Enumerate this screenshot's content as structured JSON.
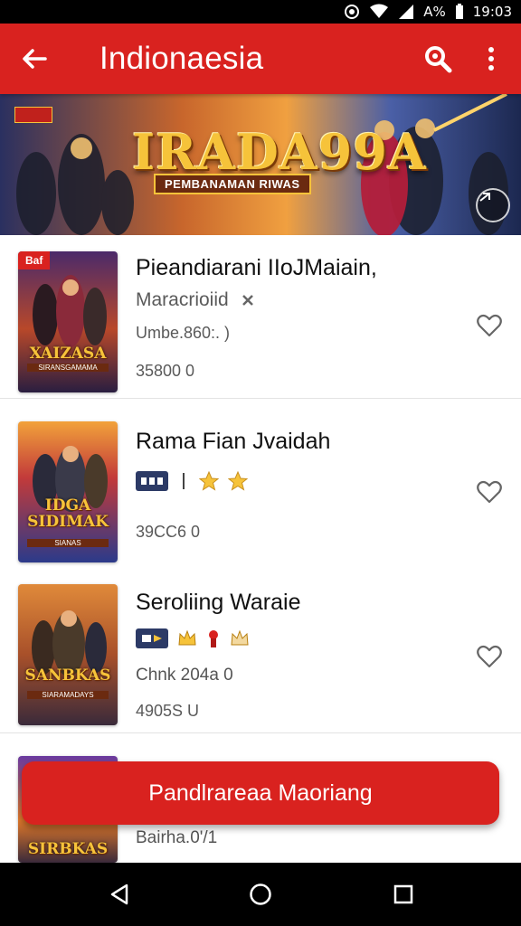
{
  "status_bar": {
    "time": "19:03",
    "battery_text": "A%"
  },
  "app_bar": {
    "title": "Indionaesia",
    "icons": [
      "back-arrow-icon",
      "search-icon",
      "more-vert-icon"
    ]
  },
  "banner": {
    "logo_text": "IRADA99A",
    "subtitle": "PEMBANAMAN RIWAS"
  },
  "games": [
    {
      "badge": "Baf",
      "cover_title": "XAIZASA",
      "cover_subtitle": "SIRANSGAMAMA",
      "name": "Pieandiarani IIoJMaiain,",
      "developer": "Maracrioiid",
      "size": "Umbe.860:. )",
      "downloads": "35800 0",
      "rating_icons": [
        "close-icon"
      ]
    },
    {
      "cover_title": "IDGA SIDIMAK",
      "cover_subtitle": "SIANAS",
      "name": "Rama Fian Jvaidah",
      "rating_icons": [
        "chip-icon",
        "star-icon",
        "star-icon"
      ],
      "downloads": "39CC6 0"
    },
    {
      "cover_title": "SANBKAS",
      "cover_subtitle": "SIARAMADAYS",
      "name": "Seroliing Waraie",
      "rating_icons": [
        "chip-icon",
        "crown-icon",
        "medal-icon",
        "crown-icon"
      ],
      "size": "Chnk 204a 0",
      "downloads": "4905S U"
    },
    {
      "cover_title": "SIRBKAS",
      "size": "Bairha.0'/1"
    }
  ],
  "cta": {
    "label": "Pandlrareaa Maoriang"
  },
  "colors": {
    "accent_red": "#d9221f",
    "status_black": "#000000",
    "star_gold": "#f6c33a"
  },
  "nav_bar": {
    "icons": [
      "back-triangle-icon",
      "home-circle-icon",
      "recents-square-icon"
    ]
  }
}
